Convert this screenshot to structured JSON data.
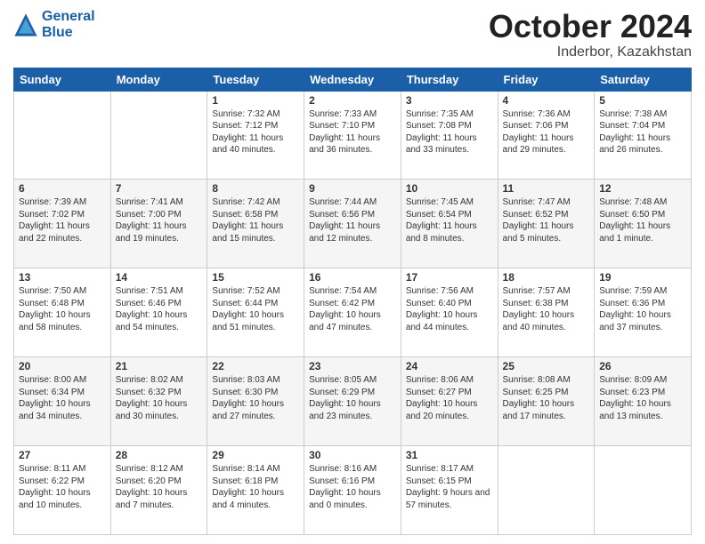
{
  "logo": {
    "line1": "General",
    "line2": "Blue"
  },
  "title": "October 2024",
  "subtitle": "Inderbor, Kazakhstan",
  "days_of_week": [
    "Sunday",
    "Monday",
    "Tuesday",
    "Wednesday",
    "Thursday",
    "Friday",
    "Saturday"
  ],
  "weeks": [
    [
      {
        "day": "",
        "sunrise": "",
        "sunset": "",
        "daylight": ""
      },
      {
        "day": "",
        "sunrise": "",
        "sunset": "",
        "daylight": ""
      },
      {
        "day": "1",
        "sunrise": "Sunrise: 7:32 AM",
        "sunset": "Sunset: 7:12 PM",
        "daylight": "Daylight: 11 hours and 40 minutes."
      },
      {
        "day": "2",
        "sunrise": "Sunrise: 7:33 AM",
        "sunset": "Sunset: 7:10 PM",
        "daylight": "Daylight: 11 hours and 36 minutes."
      },
      {
        "day": "3",
        "sunrise": "Sunrise: 7:35 AM",
        "sunset": "Sunset: 7:08 PM",
        "daylight": "Daylight: 11 hours and 33 minutes."
      },
      {
        "day": "4",
        "sunrise": "Sunrise: 7:36 AM",
        "sunset": "Sunset: 7:06 PM",
        "daylight": "Daylight: 11 hours and 29 minutes."
      },
      {
        "day": "5",
        "sunrise": "Sunrise: 7:38 AM",
        "sunset": "Sunset: 7:04 PM",
        "daylight": "Daylight: 11 hours and 26 minutes."
      }
    ],
    [
      {
        "day": "6",
        "sunrise": "Sunrise: 7:39 AM",
        "sunset": "Sunset: 7:02 PM",
        "daylight": "Daylight: 11 hours and 22 minutes."
      },
      {
        "day": "7",
        "sunrise": "Sunrise: 7:41 AM",
        "sunset": "Sunset: 7:00 PM",
        "daylight": "Daylight: 11 hours and 19 minutes."
      },
      {
        "day": "8",
        "sunrise": "Sunrise: 7:42 AM",
        "sunset": "Sunset: 6:58 PM",
        "daylight": "Daylight: 11 hours and 15 minutes."
      },
      {
        "day": "9",
        "sunrise": "Sunrise: 7:44 AM",
        "sunset": "Sunset: 6:56 PM",
        "daylight": "Daylight: 11 hours and 12 minutes."
      },
      {
        "day": "10",
        "sunrise": "Sunrise: 7:45 AM",
        "sunset": "Sunset: 6:54 PM",
        "daylight": "Daylight: 11 hours and 8 minutes."
      },
      {
        "day": "11",
        "sunrise": "Sunrise: 7:47 AM",
        "sunset": "Sunset: 6:52 PM",
        "daylight": "Daylight: 11 hours and 5 minutes."
      },
      {
        "day": "12",
        "sunrise": "Sunrise: 7:48 AM",
        "sunset": "Sunset: 6:50 PM",
        "daylight": "Daylight: 11 hours and 1 minute."
      }
    ],
    [
      {
        "day": "13",
        "sunrise": "Sunrise: 7:50 AM",
        "sunset": "Sunset: 6:48 PM",
        "daylight": "Daylight: 10 hours and 58 minutes."
      },
      {
        "day": "14",
        "sunrise": "Sunrise: 7:51 AM",
        "sunset": "Sunset: 6:46 PM",
        "daylight": "Daylight: 10 hours and 54 minutes."
      },
      {
        "day": "15",
        "sunrise": "Sunrise: 7:52 AM",
        "sunset": "Sunset: 6:44 PM",
        "daylight": "Daylight: 10 hours and 51 minutes."
      },
      {
        "day": "16",
        "sunrise": "Sunrise: 7:54 AM",
        "sunset": "Sunset: 6:42 PM",
        "daylight": "Daylight: 10 hours and 47 minutes."
      },
      {
        "day": "17",
        "sunrise": "Sunrise: 7:56 AM",
        "sunset": "Sunset: 6:40 PM",
        "daylight": "Daylight: 10 hours and 44 minutes."
      },
      {
        "day": "18",
        "sunrise": "Sunrise: 7:57 AM",
        "sunset": "Sunset: 6:38 PM",
        "daylight": "Daylight: 10 hours and 40 minutes."
      },
      {
        "day": "19",
        "sunrise": "Sunrise: 7:59 AM",
        "sunset": "Sunset: 6:36 PM",
        "daylight": "Daylight: 10 hours and 37 minutes."
      }
    ],
    [
      {
        "day": "20",
        "sunrise": "Sunrise: 8:00 AM",
        "sunset": "Sunset: 6:34 PM",
        "daylight": "Daylight: 10 hours and 34 minutes."
      },
      {
        "day": "21",
        "sunrise": "Sunrise: 8:02 AM",
        "sunset": "Sunset: 6:32 PM",
        "daylight": "Daylight: 10 hours and 30 minutes."
      },
      {
        "day": "22",
        "sunrise": "Sunrise: 8:03 AM",
        "sunset": "Sunset: 6:30 PM",
        "daylight": "Daylight: 10 hours and 27 minutes."
      },
      {
        "day": "23",
        "sunrise": "Sunrise: 8:05 AM",
        "sunset": "Sunset: 6:29 PM",
        "daylight": "Daylight: 10 hours and 23 minutes."
      },
      {
        "day": "24",
        "sunrise": "Sunrise: 8:06 AM",
        "sunset": "Sunset: 6:27 PM",
        "daylight": "Daylight: 10 hours and 20 minutes."
      },
      {
        "day": "25",
        "sunrise": "Sunrise: 8:08 AM",
        "sunset": "Sunset: 6:25 PM",
        "daylight": "Daylight: 10 hours and 17 minutes."
      },
      {
        "day": "26",
        "sunrise": "Sunrise: 8:09 AM",
        "sunset": "Sunset: 6:23 PM",
        "daylight": "Daylight: 10 hours and 13 minutes."
      }
    ],
    [
      {
        "day": "27",
        "sunrise": "Sunrise: 8:11 AM",
        "sunset": "Sunset: 6:22 PM",
        "daylight": "Daylight: 10 hours and 10 minutes."
      },
      {
        "day": "28",
        "sunrise": "Sunrise: 8:12 AM",
        "sunset": "Sunset: 6:20 PM",
        "daylight": "Daylight: 10 hours and 7 minutes."
      },
      {
        "day": "29",
        "sunrise": "Sunrise: 8:14 AM",
        "sunset": "Sunset: 6:18 PM",
        "daylight": "Daylight: 10 hours and 4 minutes."
      },
      {
        "day": "30",
        "sunrise": "Sunrise: 8:16 AM",
        "sunset": "Sunset: 6:16 PM",
        "daylight": "Daylight: 10 hours and 0 minutes."
      },
      {
        "day": "31",
        "sunrise": "Sunrise: 8:17 AM",
        "sunset": "Sunset: 6:15 PM",
        "daylight": "Daylight: 9 hours and 57 minutes."
      },
      {
        "day": "",
        "sunrise": "",
        "sunset": "",
        "daylight": ""
      },
      {
        "day": "",
        "sunrise": "",
        "sunset": "",
        "daylight": ""
      }
    ]
  ]
}
